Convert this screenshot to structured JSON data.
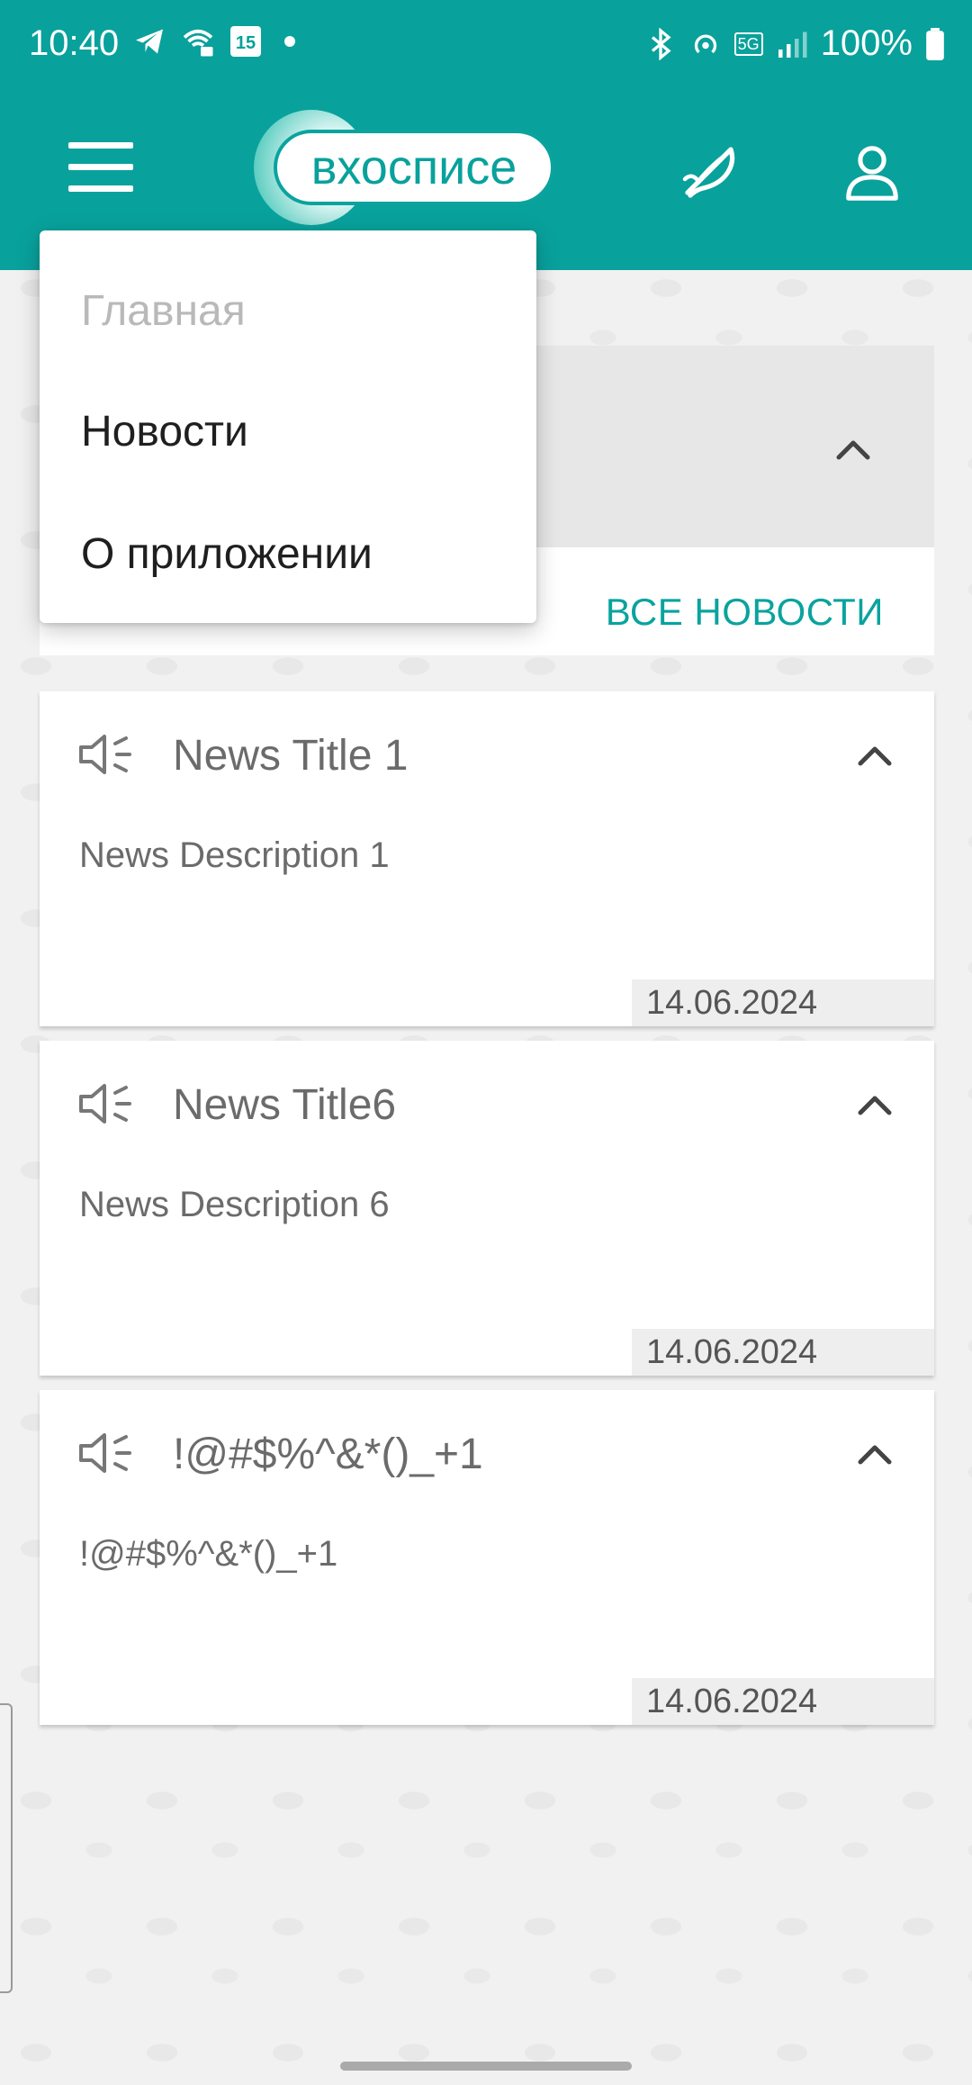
{
  "status_bar": {
    "time": "10:40",
    "calendar_day": "15",
    "battery": "100%",
    "network_badge": "5G"
  },
  "app_bar": {
    "logo_text": "вхосписе",
    "colors": {
      "primary": "#09a19c",
      "accent": "#0aa39e"
    },
    "icons": [
      "menu-icon",
      "feather-icon",
      "profile-icon"
    ]
  },
  "dropdown_menu": {
    "items": [
      {
        "label": "Главная",
        "enabled": false
      },
      {
        "label": "Новости",
        "enabled": true
      },
      {
        "label": "О приложении",
        "enabled": true
      }
    ]
  },
  "news_section": {
    "all_news_label": "ВСЕ НОВОСТИ",
    "items": [
      {
        "title": "News Title 1",
        "description": "News Description 1",
        "date": "14.06.2024"
      },
      {
        "title": "News Title6",
        "description": "News Description 6",
        "date": "14.06.2024"
      },
      {
        "title": "!@#$%^&*()_+1",
        "description": "!@#$%^&*()_+1",
        "date": "14.06.2024"
      }
    ]
  }
}
